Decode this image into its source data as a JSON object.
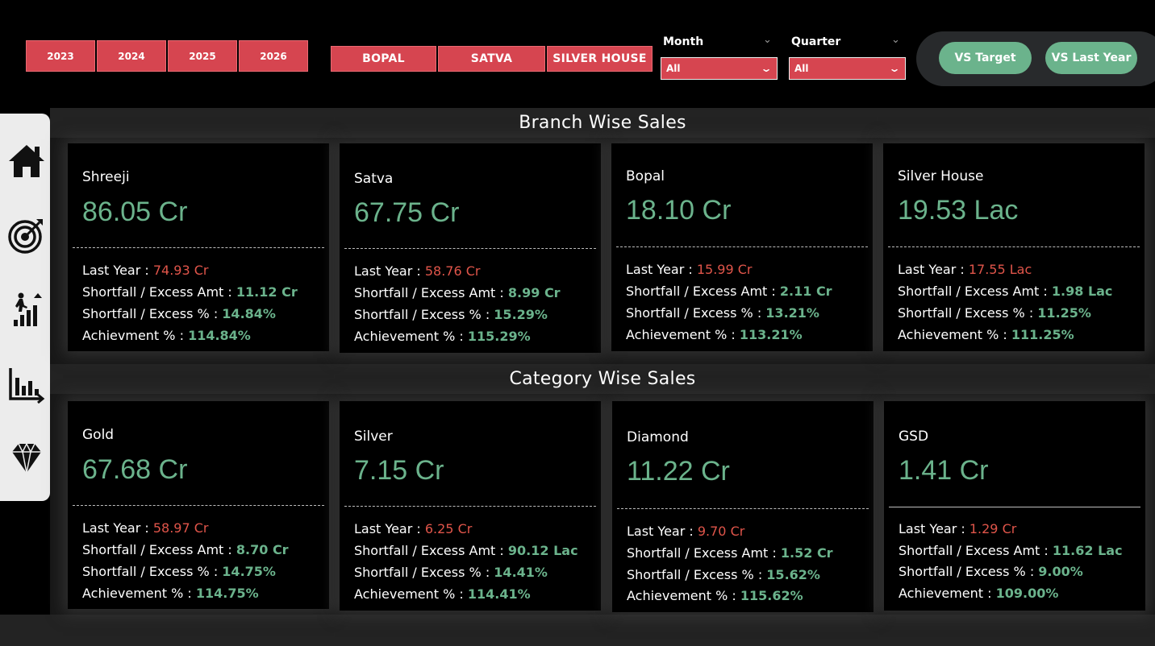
{
  "filters": {
    "years": [
      "2023",
      "2024",
      "2025",
      "2026"
    ],
    "branches": [
      "BOPAL",
      "SATVA",
      "SILVER HOUSE"
    ],
    "month": {
      "label": "Month",
      "value": "All"
    },
    "quarter": {
      "label": "Quarter",
      "value": "All"
    },
    "toggles": [
      "VS Target",
      "VS Last Year"
    ]
  },
  "sections": {
    "branch_title": "Branch Wise Sales",
    "category_title": "Category Wise Sales"
  },
  "sidebar": {
    "icons": [
      "home-icon",
      "target-icon",
      "growth-icon",
      "bar-chart-icon",
      "diamond-icon"
    ]
  },
  "colors": {
    "accent_red": "#d64550",
    "accent_green": "#6bb38c",
    "last_year_red": "#e0554a"
  },
  "branch_cards": [
    {
      "name": "Shreeji",
      "value": "86.05 Cr",
      "last_year_label": "Last Year : ",
      "last_year": "74.93 Cr",
      "amt_label": "Shortfall / Excess Amt : ",
      "amt": "11.12 Cr",
      "pct_label": "Shortfall / Excess % : ",
      "pct": "14.84%",
      "ach_label": "Achievment % : ",
      "ach": "114.84%"
    },
    {
      "name": "Satva",
      "value": "67.75 Cr",
      "last_year_label": "Last Year : ",
      "last_year": "58.76 Cr",
      "amt_label": "Shortfall / Excess Amt : ",
      "amt": "8.99 Cr",
      "pct_label": "Shortfall / Excess % : ",
      "pct": "15.29%",
      "ach_label": "Achievement % : ",
      "ach": "115.29%"
    },
    {
      "name": "Bopal",
      "value": "18.10 Cr",
      "last_year_label": "Last Year : ",
      "last_year": "15.99 Cr",
      "amt_label": "Shortfall / Excess Amt : ",
      "amt": "2.11 Cr",
      "pct_label": "Shortfall / Excess % : ",
      "pct": "13.21%",
      "ach_label": "Achievement % : ",
      "ach": "113.21%"
    },
    {
      "name": "Silver House",
      "value": "19.53 Lac",
      "last_year_label": "Last Year : ",
      "last_year": "17.55 Lac",
      "amt_label": "Shortfall / Excess Amt : ",
      "amt": "1.98 Lac",
      "pct_label": "Shortfall / Excess % : ",
      "pct": "11.25%",
      "ach_label": "Achievement % : ",
      "ach": "111.25%"
    }
  ],
  "category_cards": [
    {
      "name": "Gold",
      "value": "67.68 Cr",
      "last_year_label": "Last Year : ",
      "last_year": "58.97 Cr",
      "amt_label": "Shortfall / Excess Amt : ",
      "amt": "8.70 Cr",
      "pct_label": "Shortfall / Excess % : ",
      "pct": "14.75%",
      "ach_label": "Achievement % : ",
      "ach": "114.75%"
    },
    {
      "name": "Silver",
      "value": "7.15 Cr",
      "last_year_label": "Last Year : ",
      "last_year": "6.25 Cr",
      "amt_label": "Shortfall / Excess Amt : ",
      "amt": "90.12 Lac",
      "pct_label": "Shortfall / Excess % : ",
      "pct": "14.41%",
      "ach_label": "Achievement % : ",
      "ach": "114.41%"
    },
    {
      "name": "Diamond",
      "value": "11.22 Cr",
      "last_year_label": "Last Year : ",
      "last_year": "9.70 Cr",
      "amt_label": "Shortfall / Excess Amt : ",
      "amt": "1.52 Cr",
      "pct_label": "Shortfall / Excess % : ",
      "pct": "15.62%",
      "ach_label": "Achievement % : ",
      "ach": "115.62%"
    },
    {
      "name": "GSD",
      "value": "1.41 Cr",
      "last_year_label": "Last Year : ",
      "last_year": "1.29 Cr",
      "amt_label": "Shortfall / Excess Amt : ",
      "amt": "11.62 Lac",
      "pct_label": "Shortfall / Excess % : ",
      "pct": "9.00%",
      "ach_label": "Achievement : ",
      "ach": "109.00%"
    }
  ]
}
